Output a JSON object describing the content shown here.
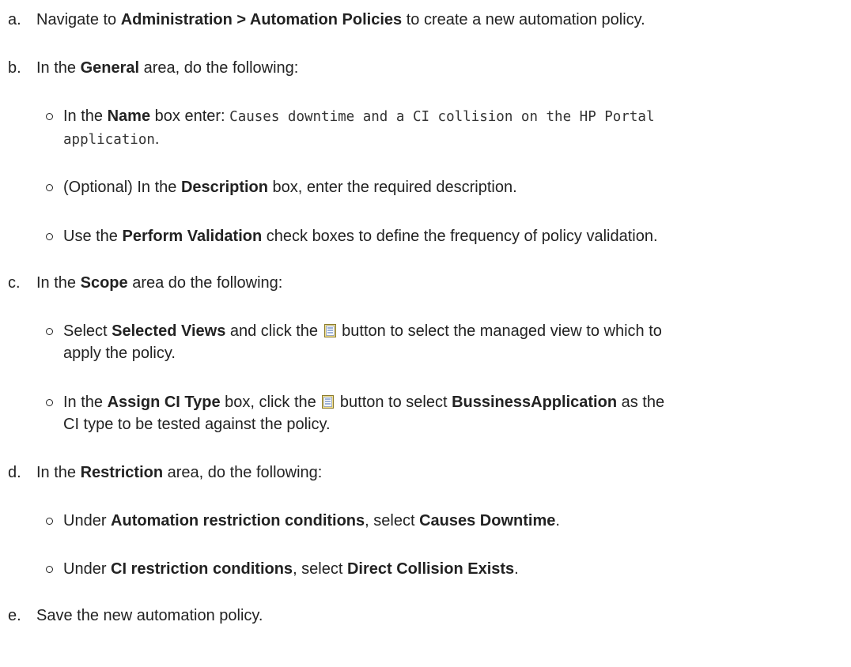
{
  "steps": [
    {
      "marker": "a.",
      "pre": "Navigate to ",
      "bold": "Administration > Automation Policies",
      "post": " to create a new automation policy."
    },
    {
      "marker": "b.",
      "pre": "In the ",
      "bold": "General",
      "post": " area, do the following:",
      "items": [
        {
          "pre": "In the ",
          "bold": "Name",
          "mid": " box enter: ",
          "code_line1": "Causes downtime and a CI collision on the HP Portal",
          "code_line2": "application",
          "post": "."
        },
        {
          "pre": "(Optional) In the ",
          "bold": "Description",
          "post": " box, enter the required description."
        },
        {
          "pre": "Use the ",
          "bold": "Perform Validation",
          "post": " check boxes to define the frequency of policy validation."
        }
      ]
    },
    {
      "marker": "c.",
      "pre": "In the ",
      "bold": "Scope",
      "post": " area do the following:",
      "items": [
        {
          "pre": "Select ",
          "bold": "Selected Views",
          "mid": " and click the ",
          "post_line1": " button to select the managed view to which to",
          "post_line2": "apply the policy."
        },
        {
          "pre": "In the ",
          "bold": "Assign CI Type",
          "mid": " box, click the ",
          "mid2": " button to select ",
          "bold2": "BussinessApplication",
          "post_line1": " as the",
          "post_line2": "CI type to be tested against the policy."
        }
      ]
    },
    {
      "marker": "d.",
      "pre": "In the ",
      "bold": "Restriction",
      "post": " area, do the following:",
      "items": [
        {
          "pre": "Under ",
          "bold": "Automation restriction conditions",
          "mid": ", select ",
          "bold2": "Causes Downtime",
          "post": "."
        },
        {
          "pre": "Under ",
          "bold": "CI restriction conditions",
          "mid": ", select ",
          "bold2": "Direct Collision Exists",
          "post": "."
        }
      ]
    },
    {
      "marker": "e.",
      "pre": "Save the new automation policy.",
      "bold": "",
      "post": ""
    }
  ]
}
